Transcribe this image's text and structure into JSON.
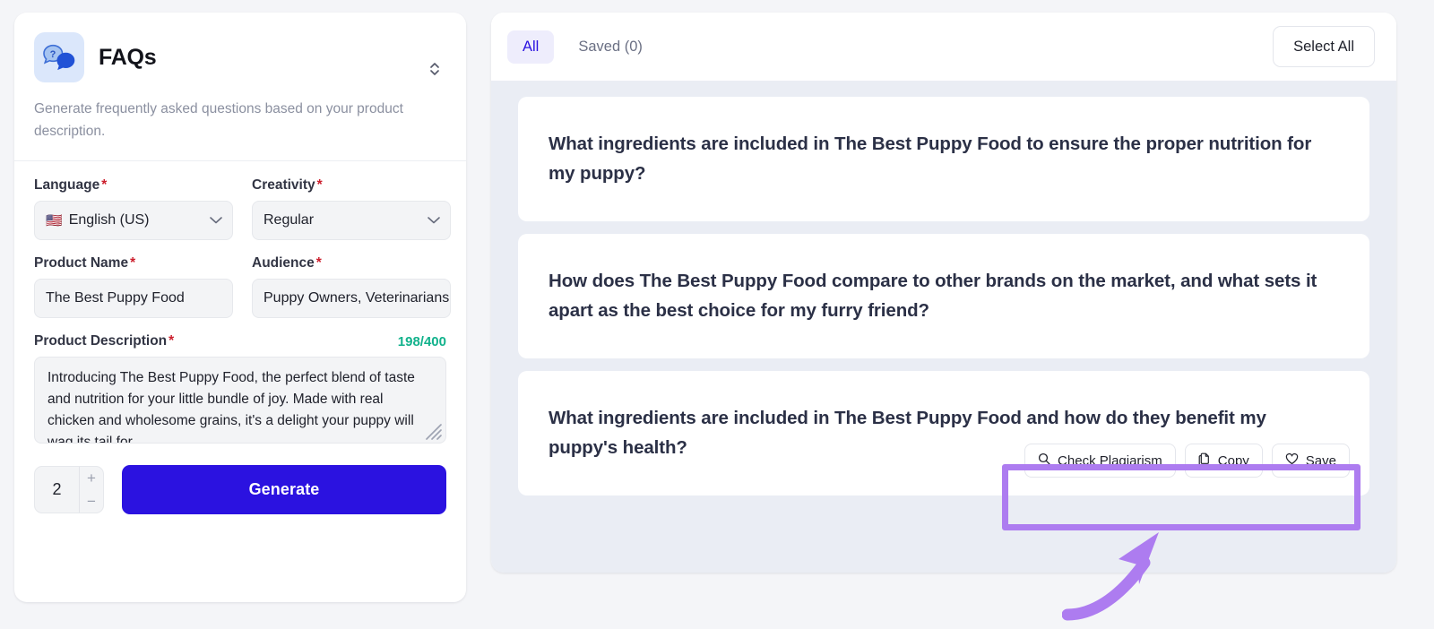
{
  "tool_panel": {
    "icon": "faq-speech-bubbles-icon",
    "title": "FAQs",
    "description": "Generate frequently asked questions based on your product description.",
    "collapse_icon": "chevron-up-down-icon",
    "fields": {
      "language": {
        "label": "Language",
        "required_marker": "*",
        "value": "English (US)",
        "flag": "🇺🇸",
        "chevron": "chevron-down-icon"
      },
      "creativity": {
        "label": "Creativity",
        "required_marker": "*",
        "value": "Regular",
        "chevron": "chevron-down-icon"
      },
      "product_name": {
        "label": "Product Name",
        "required_marker": "*",
        "value": "The Best Puppy Food",
        "placeholder": "Product Name"
      },
      "audience": {
        "label": "Audience",
        "required_marker": "*",
        "value": "Puppy Owners, Veterinarians",
        "placeholder": "Audience"
      },
      "product_description": {
        "label": "Product Description",
        "required_marker": "*",
        "counter": "198/400",
        "value": "Introducing The Best Puppy Food, the perfect blend of taste and nutrition for your little bundle of joy. Made with real chicken and wholesome grains, it's a delight your puppy will wag its tail for.",
        "placeholder": "Product Description"
      }
    },
    "quantity": {
      "value": "2",
      "increment_label": "+",
      "decrement_label": "−"
    },
    "generate_label": "Generate"
  },
  "results": {
    "tabs": [
      {
        "label": "All",
        "active": true
      },
      {
        "label": "Saved (0)",
        "active": false
      }
    ],
    "select_all_label": "Select All",
    "items": [
      {
        "question": "What ingredients are included in The Best Puppy Food to ensure the proper nutrition for my puppy?",
        "show_actions": false
      },
      {
        "question": "How does The Best Puppy Food compare to other brands on the market, and what sets it apart as the best choice for my furry friend?",
        "show_actions": false
      },
      {
        "question": "What ingredients are included in The Best Puppy Food and how do they benefit my puppy's health?",
        "show_actions": true
      }
    ],
    "actions": [
      {
        "label": "Check Plagiarism",
        "icon": "search-icon"
      },
      {
        "label": "Copy",
        "icon": "copy-icon"
      },
      {
        "label": "Save",
        "icon": "heart-icon"
      }
    ]
  },
  "annotation": {
    "highlight_color": "#ad7cf0",
    "arrow_icon": "curved-arrow-up-right-icon"
  },
  "colors": {
    "brand": "#2b12e0",
    "accent_tab": "#2b12e0",
    "counter_green": "#12b28c",
    "required_red": "#cc1f2d",
    "annotation_purple": "#ad7cf0",
    "results_bg": "#eaedf4",
    "page_bg": "#f4f5f8"
  }
}
